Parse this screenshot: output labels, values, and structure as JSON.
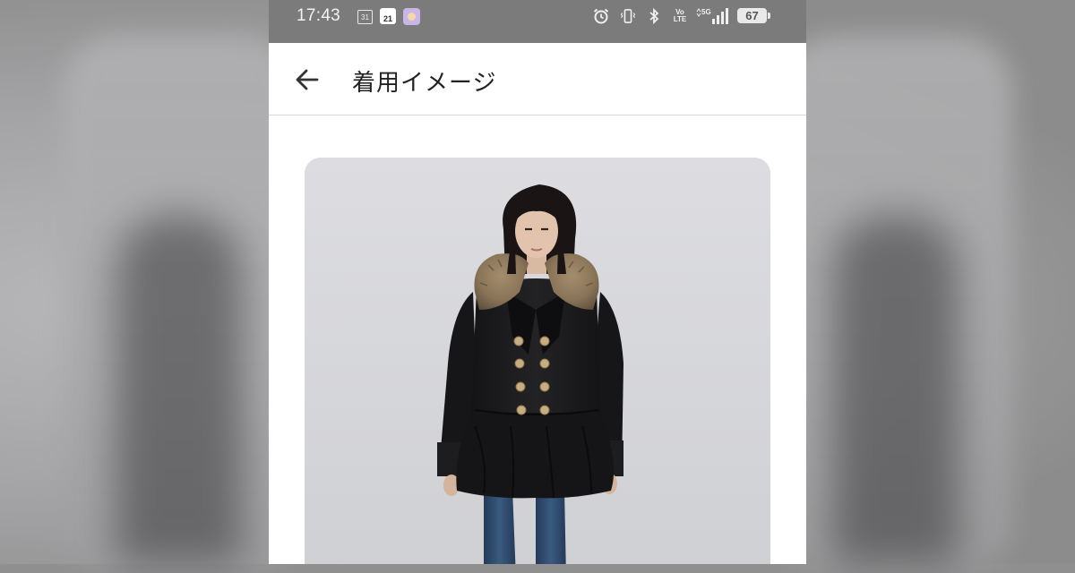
{
  "status_bar": {
    "time": "17:43",
    "calendar_day_small": "31",
    "calendar_day": "21",
    "network_top": "Vo",
    "network_bottom": "LTE",
    "network_type": "5G",
    "battery_percent": "67"
  },
  "header": {
    "title": "着用イメージ",
    "back_icon": "arrow-left-icon"
  },
  "content": {
    "image": "model-wearing-black-coat-with-fur-collar"
  },
  "colors": {
    "status_bar_bg": "#7b7b7b",
    "header_bg": "#ffffff",
    "photo_bg": "#d6d7db",
    "coat": "#1c1c1e",
    "fur_collar": "#8a7458",
    "jeans": "#2f4a6b"
  }
}
